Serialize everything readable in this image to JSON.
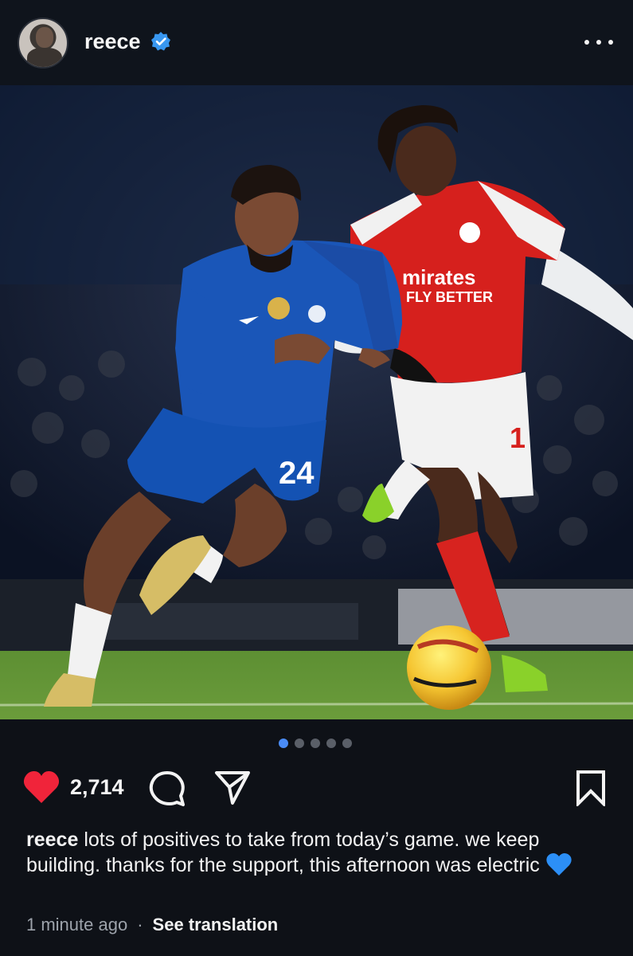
{
  "post": {
    "username": "reece",
    "verified": true,
    "avatar_icon": "profile-avatar",
    "photo_description_icon": "post-photo",
    "carousel": {
      "count": 5,
      "active_index": 0
    },
    "likes": "2,714",
    "caption_username": "reece",
    "caption_text": "lots of positives to take from today’s game. we keep building. thanks for the support, this afternoon was electric",
    "caption_emoji": "blue-heart-icon",
    "timestamp": "1 minute ago",
    "separator": "·",
    "see_translation": "See translation"
  },
  "colors": {
    "background": "#0e1117",
    "like_red": "#f0243a",
    "verified_blue": "#3897f0",
    "active_dot": "#4a8cf7",
    "muted_text": "#9da3ab"
  },
  "photo_text": {
    "sponsor_line1": "mirates",
    "sponsor_line2": "FLY BETTER",
    "chelsea_number": "24",
    "arsenal_number": "1"
  }
}
